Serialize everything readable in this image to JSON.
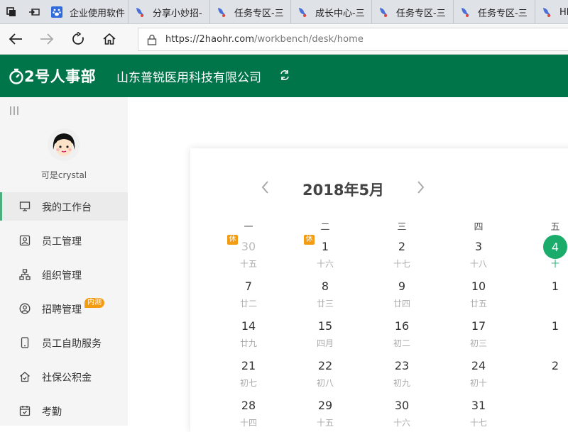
{
  "browser": {
    "tabs": [
      {
        "title": "企业使用软件",
        "icon": "baidu-paw-icon"
      },
      {
        "title": "分享小妙招-",
        "icon": "bird-icon"
      },
      {
        "title": "任务专区-三",
        "icon": "bird-icon"
      },
      {
        "title": "成长中心-三",
        "icon": "bird-icon"
      },
      {
        "title": "任务专区-三",
        "icon": "bird-icon"
      },
      {
        "title": "任务专区-三",
        "icon": "bird-icon"
      },
      {
        "title": "HR",
        "icon": "bird-icon"
      }
    ],
    "url_host": "https://2haohr.com",
    "url_path": "/workbench/desk/home"
  },
  "header": {
    "logo_text": "2号人事部",
    "company": "山东普锐医用科技有限公司"
  },
  "sidebar": {
    "username": "可是crystal",
    "items": [
      {
        "label": "我的工作台",
        "icon": "monitor-icon",
        "active": true
      },
      {
        "label": "员工管理",
        "icon": "person-card-icon"
      },
      {
        "label": "组织管理",
        "icon": "org-chart-icon"
      },
      {
        "label": "招聘管理",
        "icon": "user-circle-icon",
        "badge": "内测"
      },
      {
        "label": "员工自助服务",
        "icon": "phone-icon"
      },
      {
        "label": "社保公积金",
        "icon": "home-shield-icon"
      },
      {
        "label": "考勤",
        "icon": "calendar-check-icon"
      }
    ]
  },
  "calendar": {
    "title": "2018年5月",
    "weekdays": [
      "一",
      "二",
      "三",
      "四",
      "五"
    ],
    "weeks": [
      [
        {
          "day": "30",
          "lunar": "十五",
          "muted": true,
          "rest": "休"
        },
        {
          "day": "1",
          "lunar": "十六",
          "rest": "休"
        },
        {
          "day": "2",
          "lunar": "十七"
        },
        {
          "day": "3",
          "lunar": "十八"
        },
        {
          "day": "4",
          "lunar": "十",
          "today": true
        }
      ],
      [
        {
          "day": "7",
          "lunar": "廿二"
        },
        {
          "day": "8",
          "lunar": "廿三"
        },
        {
          "day": "9",
          "lunar": "廿四"
        },
        {
          "day": "10",
          "lunar": "廿五"
        },
        {
          "day": "1",
          "lunar": ""
        }
      ],
      [
        {
          "day": "14",
          "lunar": "廿九"
        },
        {
          "day": "15",
          "lunar": "四月"
        },
        {
          "day": "16",
          "lunar": "初二"
        },
        {
          "day": "17",
          "lunar": "初三"
        },
        {
          "day": "1",
          "lunar": ""
        }
      ],
      [
        {
          "day": "21",
          "lunar": "初七"
        },
        {
          "day": "22",
          "lunar": "初八"
        },
        {
          "day": "23",
          "lunar": "初九"
        },
        {
          "day": "24",
          "lunar": "初十"
        },
        {
          "day": "2",
          "lunar": ""
        }
      ],
      [
        {
          "day": "28",
          "lunar": "十四"
        },
        {
          "day": "29",
          "lunar": "十五"
        },
        {
          "day": "30",
          "lunar": "十六"
        },
        {
          "day": "31",
          "lunar": "十七"
        },
        {
          "day": "",
          "lunar": ""
        }
      ]
    ]
  },
  "colors": {
    "brand": "#00754a",
    "today": "#1bab6b",
    "badge": "#f39c12"
  }
}
